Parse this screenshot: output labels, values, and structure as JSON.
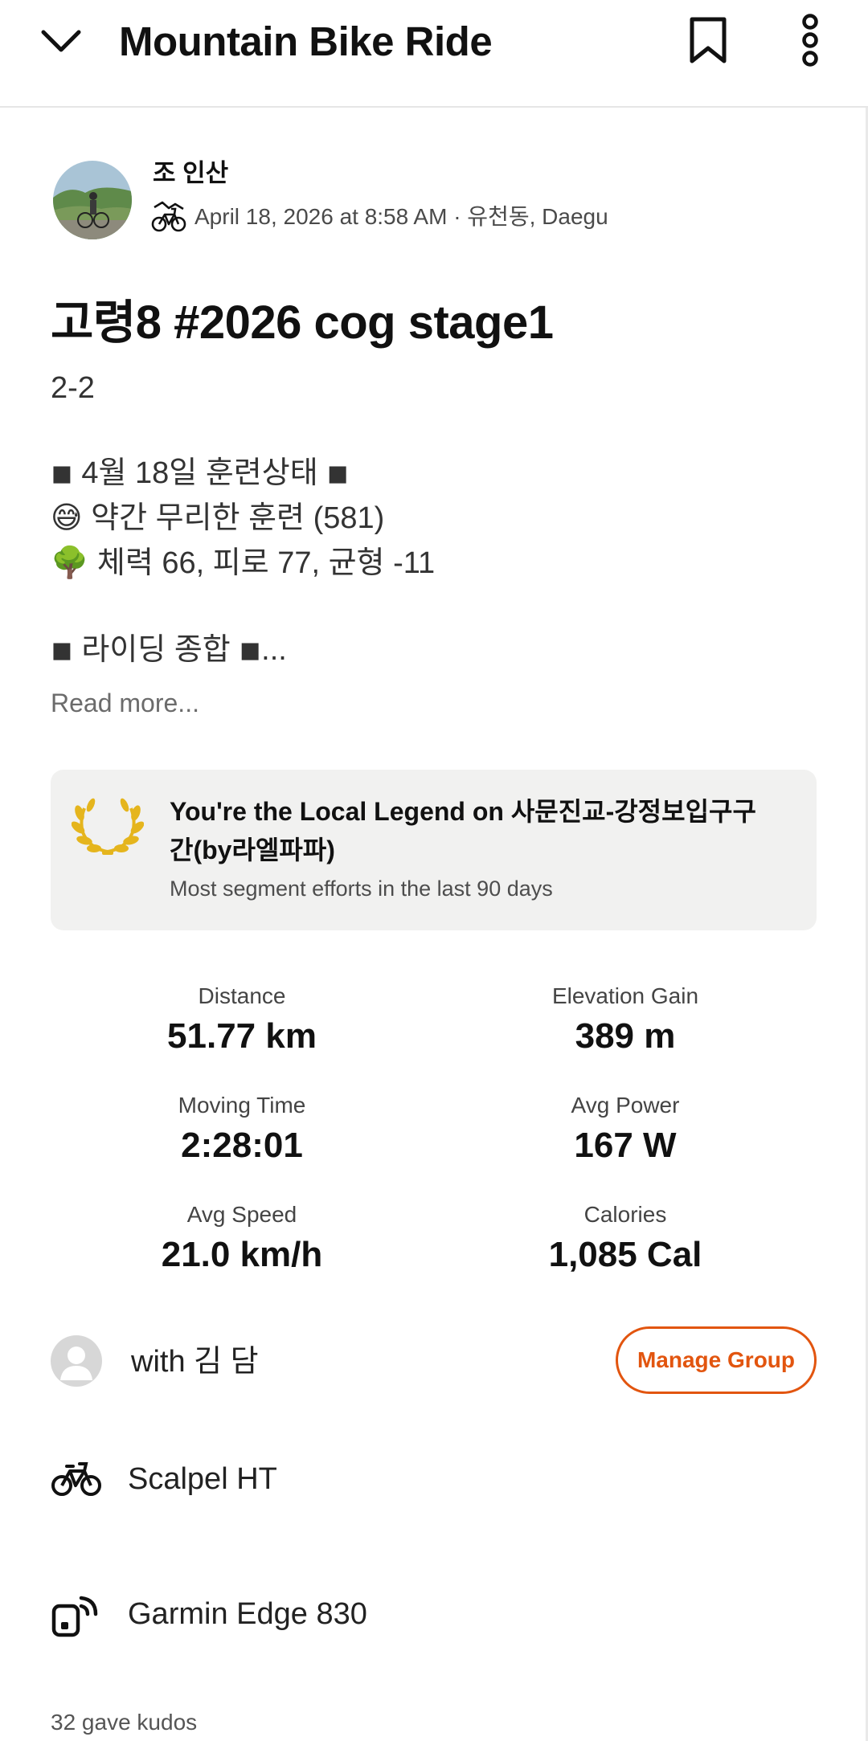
{
  "header": {
    "title": "Mountain Bike Ride"
  },
  "athlete": {
    "name": "조 인산",
    "meta": "April 18, 2026 at 8:58 AM · 유천동, Daegu"
  },
  "activity": {
    "title": "고령8 #2026 cog stage1",
    "description_lines": [
      "2-2",
      "◾ 4월 18일 훈련상태 ◾",
      "😅 약간 무리한 훈련 (581)",
      "🌳 체력 66, 피로 77, 균형 -11",
      "◾ 라이딩 종합 ◾..."
    ],
    "read_more": "Read more..."
  },
  "local_legend": {
    "title": "You're the Local Legend on 사문진교-강정보입구구간(by라엘파파)",
    "subtitle": "Most segment efforts in the last 90 days",
    "accent_color": "#e5b51d"
  },
  "stats": [
    {
      "label": "Distance",
      "value": "51.77 km"
    },
    {
      "label": "Elevation Gain",
      "value": "389 m"
    },
    {
      "label": "Moving Time",
      "value": "2:28:01"
    },
    {
      "label": "Avg Power",
      "value": "167 W"
    },
    {
      "label": "Avg Speed",
      "value": "21.0 km/h"
    },
    {
      "label": "Calories",
      "value": "1,085 Cal"
    }
  ],
  "group": {
    "text": "with 김 담",
    "manage_label": "Manage Group",
    "accent_color": "#e2550f"
  },
  "gear": {
    "bike": "Scalpel HT",
    "device": "Garmin Edge 830"
  },
  "kudos": {
    "text": "32 gave kudos"
  }
}
